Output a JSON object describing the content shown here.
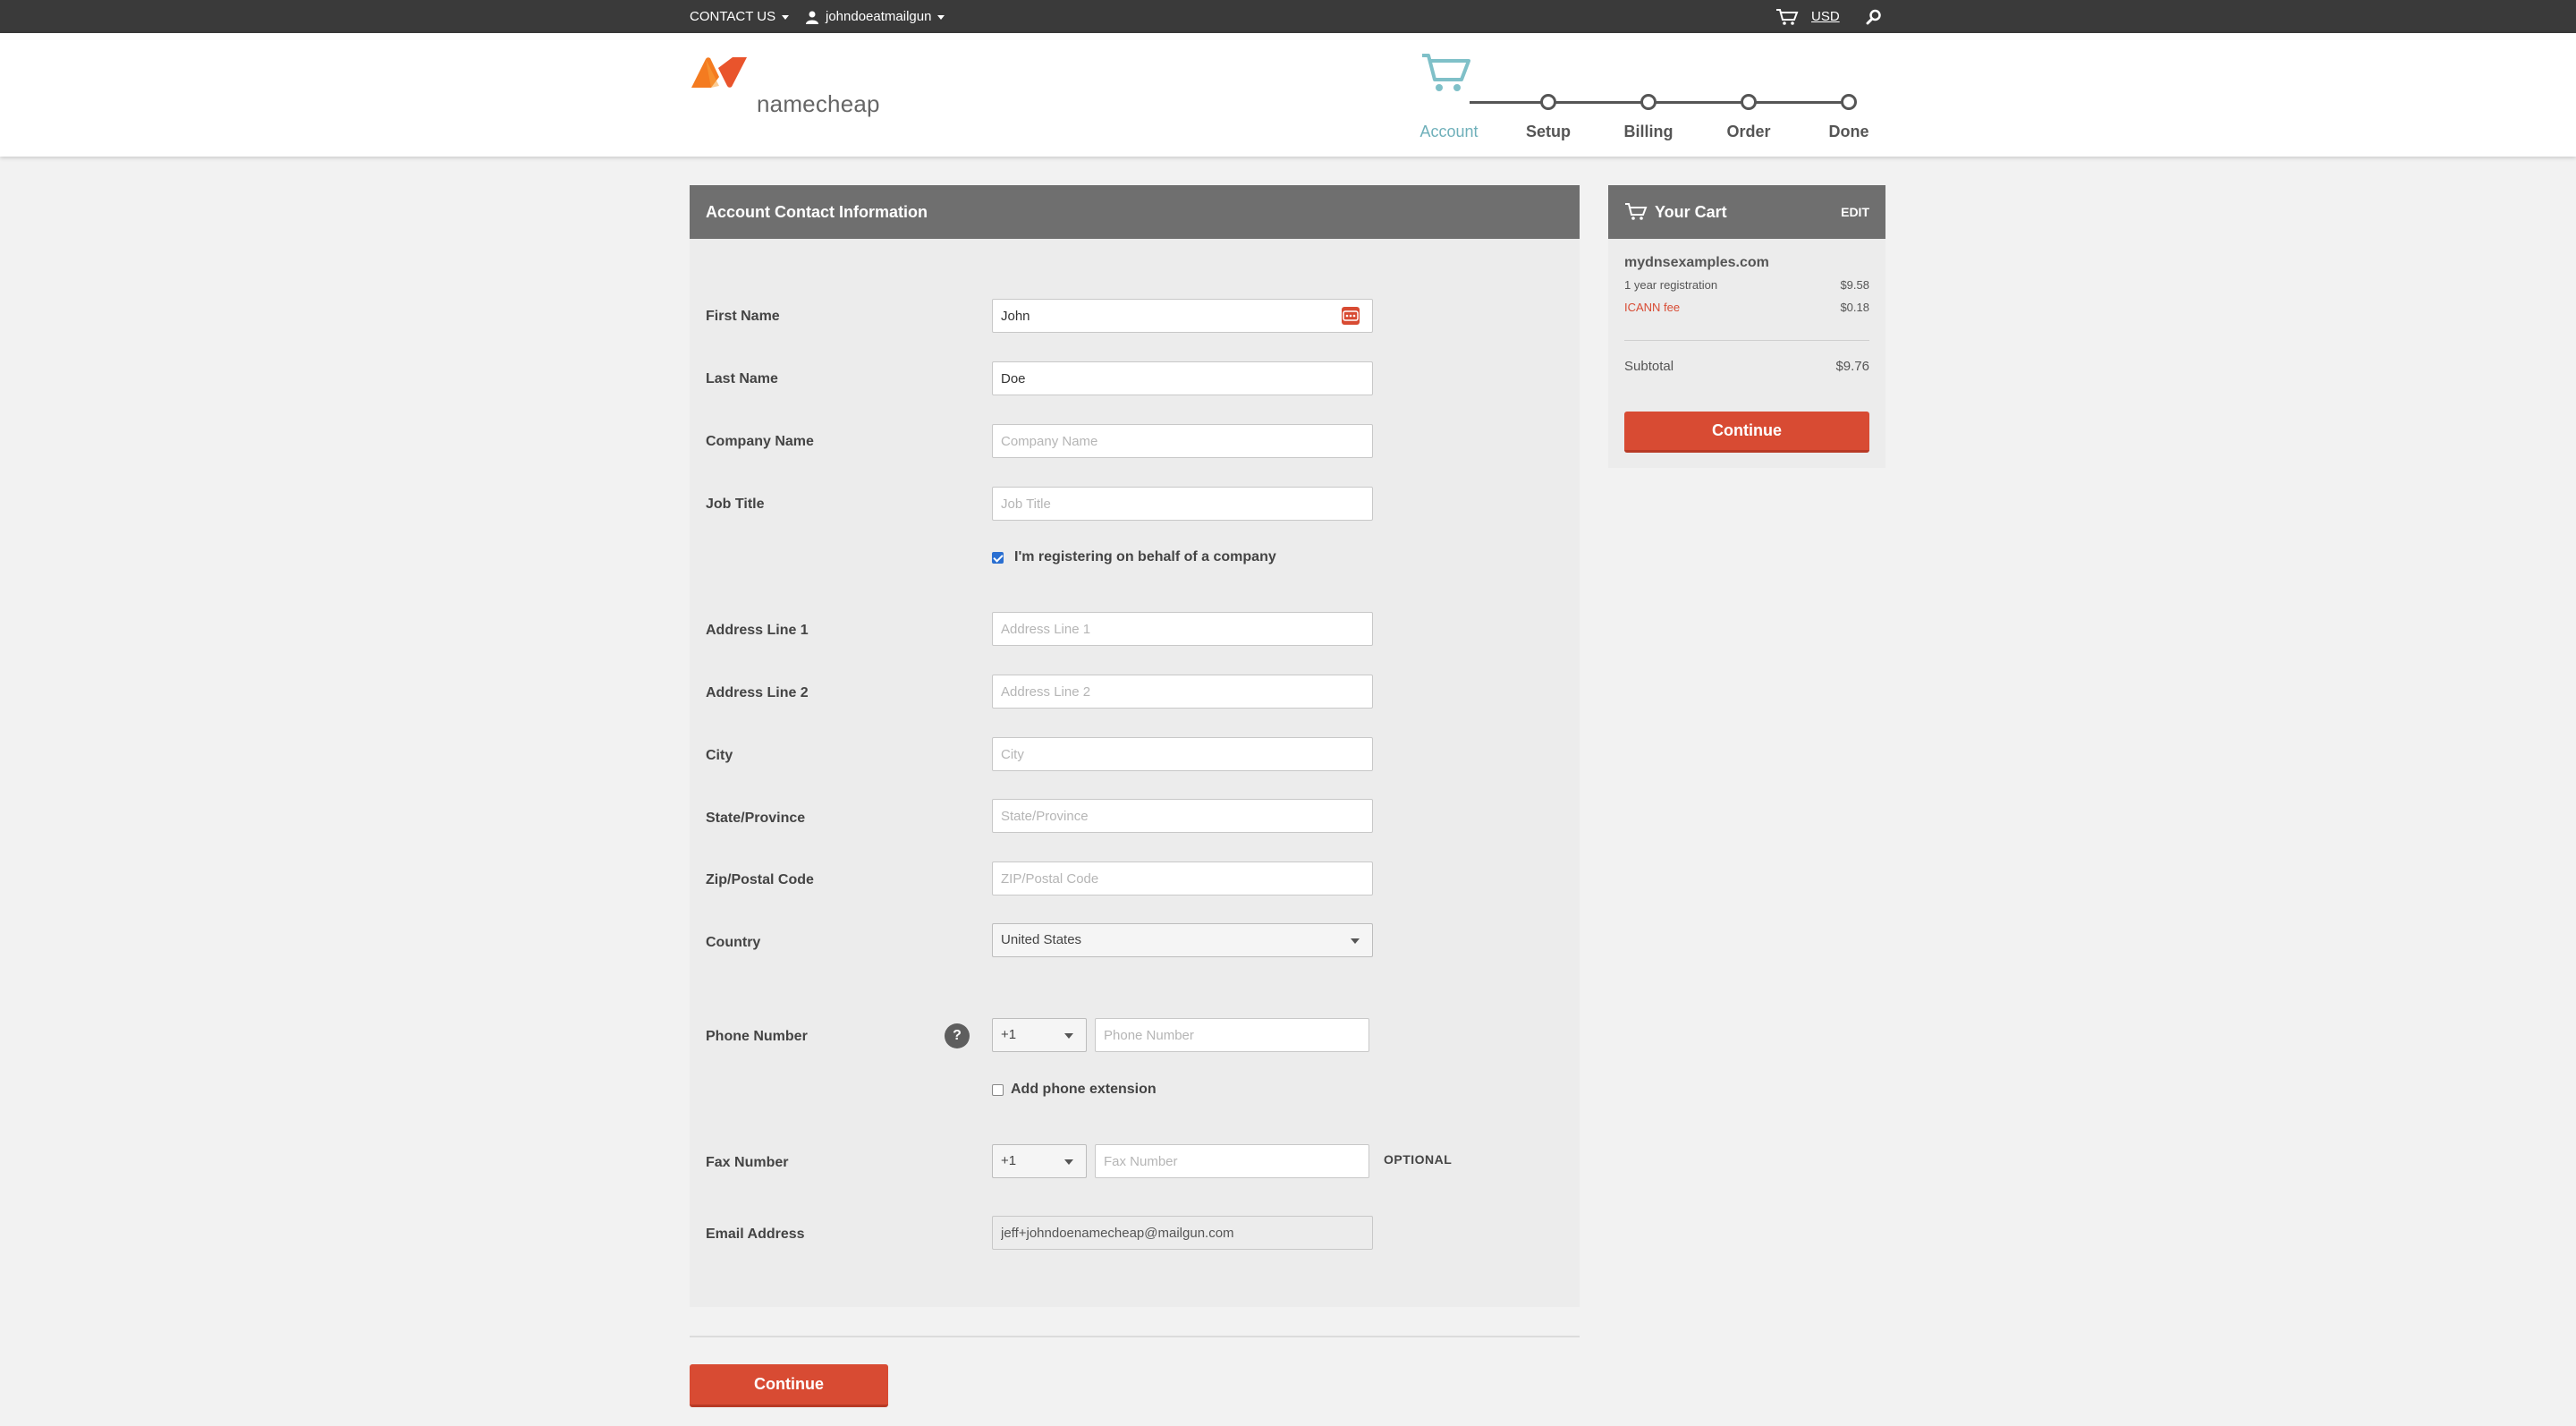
{
  "topbar": {
    "contact_label": "CONTACT US",
    "user_label": "johndoeatmailgun",
    "currency_label": "USD",
    "icons": [
      "user-icon",
      "cart-icon",
      "search-icon"
    ]
  },
  "brand": {
    "name": "namecheap",
    "accent": "#d84b33",
    "logo_colors": [
      "#f47b20",
      "#e9542c"
    ]
  },
  "steps": [
    {
      "label": "Account",
      "active": true
    },
    {
      "label": "Setup",
      "active": false
    },
    {
      "label": "Billing",
      "active": false
    },
    {
      "label": "Order",
      "active": false
    },
    {
      "label": "Done",
      "active": false
    }
  ],
  "form": {
    "title": "Account Contact Information",
    "first_name": {
      "label": "First Name",
      "value": "John"
    },
    "last_name": {
      "label": "Last Name",
      "value": "Doe"
    },
    "company_name": {
      "label": "Company Name",
      "placeholder": "Company Name"
    },
    "job_title": {
      "label": "Job Title",
      "placeholder": "Job Title"
    },
    "company_checkbox": {
      "label": "I'm registering on behalf of a company",
      "checked": true
    },
    "address1": {
      "label": "Address Line 1",
      "placeholder": "Address Line 1"
    },
    "address2": {
      "label": "Address Line 2",
      "placeholder": "Address Line 2"
    },
    "city": {
      "label": "City",
      "placeholder": "City"
    },
    "state": {
      "label": "State/Province",
      "placeholder": "State/Province"
    },
    "zip": {
      "label": "Zip/Postal Code",
      "placeholder": "ZIP/Postal Code"
    },
    "country": {
      "label": "Country",
      "value": "United States"
    },
    "phone": {
      "label": "Phone Number",
      "code": "+1",
      "placeholder": "Phone Number",
      "help": "?"
    },
    "phone_extension": {
      "label": "Add phone extension",
      "checked": false
    },
    "fax": {
      "label": "Fax Number",
      "code": "+1",
      "placeholder": "Fax Number",
      "optional": "OPTIONAL"
    },
    "email": {
      "label": "Email Address",
      "value": "jeff+johndoenamecheap@mailgun.com"
    },
    "continue_label": "Continue"
  },
  "cart": {
    "title": "Your Cart",
    "edit_label": "EDIT",
    "domain": "mydnsexamples.com",
    "items": [
      {
        "label": "1 year registration",
        "price": "$9.58"
      },
      {
        "label": "ICANN fee",
        "price": "$0.18"
      }
    ],
    "subtotal_label": "Subtotal",
    "subtotal": "$9.76",
    "continue_label": "Continue"
  }
}
